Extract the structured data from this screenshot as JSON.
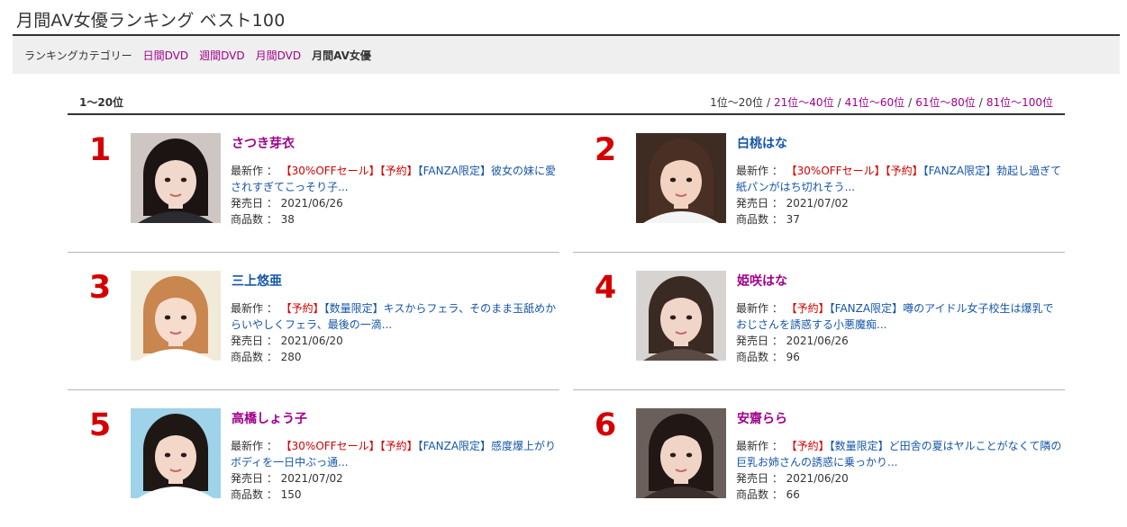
{
  "page": {
    "title": "月間AV女優ランキング ベスト100"
  },
  "categories": {
    "label": "ランキングカテゴリー",
    "links": [
      "日間DVD",
      "週間DVD",
      "月間DVD"
    ],
    "current": "月間AV女優"
  },
  "range": {
    "current": "1〜20位",
    "pages": [
      "1位〜20位",
      "21位〜40位",
      "41位〜60位",
      "61位〜80位",
      "81位〜100位"
    ],
    "separator": "/"
  },
  "labels": {
    "latest": "最新作 ：",
    "release": "発売日 ：",
    "count": "商品数 ："
  },
  "accent_colors": {
    "link_pink": "#a0008a",
    "link_blue": "#1556a8",
    "rank_red": "#d40000",
    "tag_red": "#d40000"
  },
  "entries": [
    {
      "rank": "1",
      "name": "さつき芽衣",
      "name_color": "pink",
      "tags": [
        "【30%OFFセール】",
        "【予約】"
      ],
      "title": "【FANZA限定】彼女の妹に愛されすぎてこっそり子...",
      "release": "2021/06/26",
      "count": "38",
      "photo": {
        "bg": "#cdc6c3",
        "hair": "#1b1412",
        "skin": "#f1d8cc",
        "cloth": "#2a2a30"
      }
    },
    {
      "rank": "2",
      "name": "白桃はな",
      "name_color": "blue",
      "tags": [
        "【30%OFFセール】",
        "【予約】"
      ],
      "title": "【FANZA限定】勃起し過ぎて紙パンがはち切れそう...",
      "release": "2021/07/02",
      "count": "37",
      "photo": {
        "bg": "#3e2b22",
        "hair": "#4a3024",
        "skin": "#f2d3c2",
        "cloth": "#f4f4f4"
      }
    },
    {
      "rank": "3",
      "name": "三上悠亜",
      "name_color": "blue",
      "tags": [
        "【予約】"
      ],
      "title": "【数量限定】キスからフェラ、そのまま玉舐めからいやしくフェラ、最後の一滴...",
      "release": "2021/06/20",
      "count": "280",
      "photo": {
        "bg": "#f2ead8",
        "hair": "#c9864f",
        "skin": "#f5dccd",
        "cloth": "#ffffff"
      }
    },
    {
      "rank": "4",
      "name": "姫咲はな",
      "name_color": "pink",
      "tags": [
        "【予約】"
      ],
      "title": "【FANZA限定】噂のアイドル女子校生は爆乳でおじさんを誘惑する小悪魔痴...",
      "release": "2021/06/26",
      "count": "96",
      "photo": {
        "bg": "#d7d3d0",
        "hair": "#3a2a24",
        "skin": "#f0d6c8",
        "cloth": "#5a4a44"
      }
    },
    {
      "rank": "5",
      "name": "高橋しょう子",
      "name_color": "pink",
      "tags": [
        "【30%OFFセール】",
        "【予約】"
      ],
      "title": "【FANZA限定】感度爆上がりボディを一日中ぶっ通...",
      "release": "2021/07/02",
      "count": "150",
      "photo": {
        "bg": "#9fd3ea",
        "hair": "#1e1714",
        "skin": "#f3d7c8",
        "cloth": "#ffffff"
      }
    },
    {
      "rank": "6",
      "name": "安齋らら",
      "name_color": "pink",
      "tags": [
        "【予約】"
      ],
      "title": "【数量限定】ど田舎の夏はヤルことがなくて隣の巨乳お姉さんの誘惑に乗っかり...",
      "release": "2021/06/20",
      "count": "66",
      "photo": {
        "bg": "#6b5f5c",
        "hair": "#211816",
        "skin": "#f0d5c6",
        "cloth": "#3a2f2c"
      }
    }
  ]
}
